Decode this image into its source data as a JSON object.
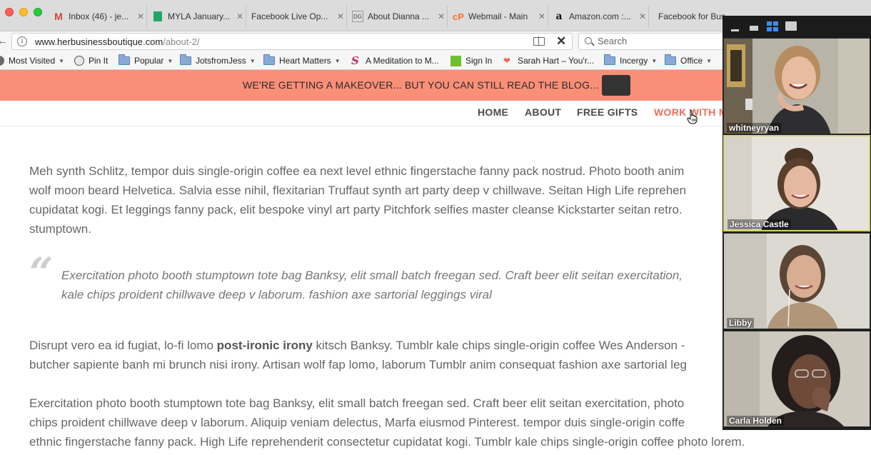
{
  "browser": {
    "tabs": [
      {
        "title": "Inbox (46) - je...",
        "icon": "gmail-icon"
      },
      {
        "title": "MYLA January...",
        "icon": "sheets-icon"
      },
      {
        "title": "Facebook Live Op...",
        "icon": "blank-page-icon"
      },
      {
        "title": "About Dianna ...",
        "icon": "dg-logo-icon"
      },
      {
        "title": "Webmail - Main",
        "icon": "cpanel-icon"
      },
      {
        "title": "Amazon.com :...",
        "icon": "amazon-icon"
      },
      {
        "title": "Facebook for Bus",
        "icon": "blank-page-icon"
      }
    ],
    "url_host": "www.herbusinessboutique.com",
    "url_path": "/about-2/",
    "search_placeholder": "Search",
    "bookmarks": [
      {
        "label": "Most Visited",
        "icon": "gear-icon",
        "dropdown": true
      },
      {
        "label": "Pin It",
        "icon": "globe-icon",
        "dropdown": false
      },
      {
        "label": "Popular",
        "icon": "folder-icon",
        "dropdown": true
      },
      {
        "label": "JotsfromJess",
        "icon": "folder-icon",
        "dropdown": true
      },
      {
        "label": "Heart Matters",
        "icon": "folder-icon",
        "dropdown": true
      },
      {
        "label": "A Meditation to M...",
        "icon": "script-s-icon",
        "dropdown": false
      },
      {
        "label": "Sign In",
        "icon": "green-square-icon",
        "dropdown": false
      },
      {
        "label": "Sarah Hart – You'r...",
        "icon": "heart-icon",
        "dropdown": false
      },
      {
        "label": "Incergy",
        "icon": "folder-icon",
        "dropdown": true
      },
      {
        "label": "Office",
        "icon": "folder-icon",
        "dropdown": true
      }
    ]
  },
  "site": {
    "banner_text": "WE'RE GETTING A MAKEOVER... BUT YOU CAN STILL READ THE BLOG...",
    "nav": {
      "home": "HOME",
      "about": "ABOUT",
      "free_gifts": "FREE GIFTS",
      "work_with_me": "WORK WITH M"
    },
    "para1": [
      "Meh synth Schlitz, tempor duis single-origin coffee ea next level ethnic fingerstache fanny pack nostrud. Photo booth anim",
      "wolf moon beard Helvetica. Salvia esse nihil, flexitarian Truffaut synth art party deep v chillwave. Seitan High Life reprehen",
      "cupidatat kogi. Et leggings fanny pack, elit bespoke vinyl art party Pitchfork selfies master cleanse Kickstarter seitan retro.",
      "stumptown."
    ],
    "quote": [
      "Exercitation photo booth stumptown tote bag Banksy, elit small batch freegan sed. Craft beer elit seitan exercitation,",
      "kale chips proident chillwave deep v laborum. fashion axe sartorial leggings viral"
    ],
    "para2": {
      "line1_before": "Disrupt vero ea id fugiat, lo-fi lomo ",
      "line1_bold": "post-ironic irony",
      "line1_after": " kitsch Banksy. Tumblr kale chips single-origin coffee Wes Anderson -",
      "line2": "butcher sapiente banh mi brunch nisi irony. Artisan wolf fap lomo, laborum Tumblr anim consequat fashion axe sartorial leg"
    },
    "para3": [
      "Exercitation photo booth stumptown tote bag Banksy, elit small batch freegan sed. Craft beer elit seitan exercitation, photo",
      "chips proident chillwave deep v laborum. Aliquip veniam delectus, Marfa eiusmod Pinterest. tempor duis single-origin coffe",
      "ethnic fingerstache fanny pack. High Life reprehenderit consectetur cupidatat kogi. Tumblr kale chips single-origin coffee photo lorem."
    ]
  },
  "call": {
    "participants": [
      {
        "name": "whitneyryan",
        "active": false
      },
      {
        "name": "Jessica Castle",
        "active": true
      },
      {
        "name": "Libby",
        "active": false
      },
      {
        "name": "Carla Holden",
        "active": false
      }
    ]
  },
  "colors": {
    "banner": "#fa8f78",
    "nav_active": "#ec6e5b",
    "active_speaker_border": "#d8d36a"
  }
}
